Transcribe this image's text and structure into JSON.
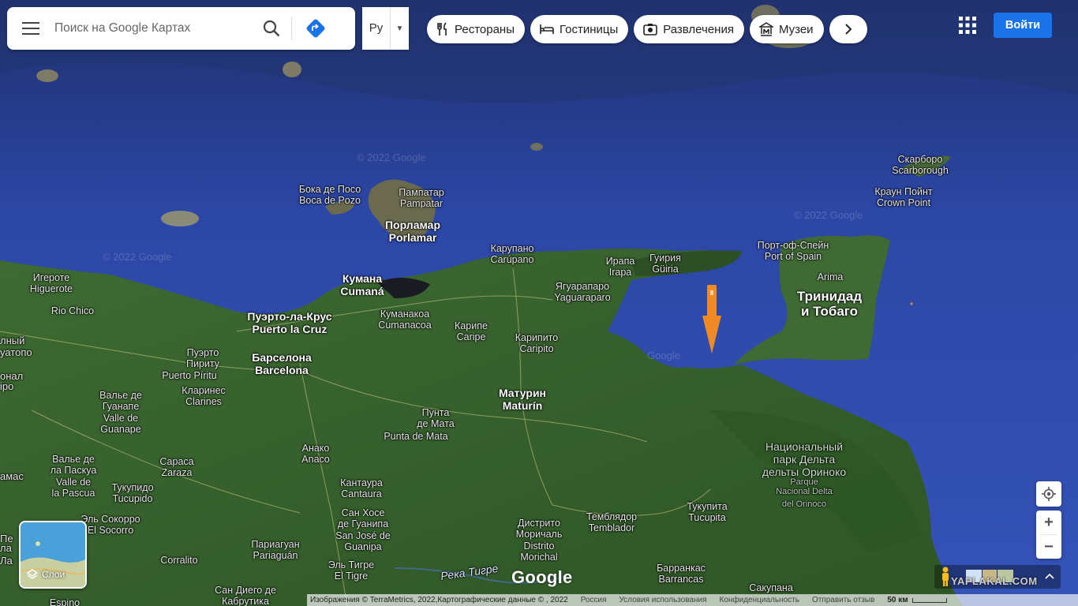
{
  "search": {
    "placeholder": "Поиск на Google Картах"
  },
  "language": {
    "code": "Ру"
  },
  "chips": [
    {
      "label": "Рестораны",
      "icon": "fork-knife-icon"
    },
    {
      "label": "Гостиницы",
      "icon": "bed-icon"
    },
    {
      "label": "Развлечения",
      "icon": "camera-icon"
    },
    {
      "label": "Музеи",
      "icon": "museum-icon"
    }
  ],
  "signin": {
    "label": "Войти"
  },
  "layers": {
    "label": "Слои"
  },
  "zoom": {
    "in": "+",
    "out": "−"
  },
  "google_logo": "Google",
  "yaplakal": "YAPLAKAL.COM",
  "attribution": {
    "credit": "Изображения © TerraMetrics, 2022,Картографические данные © , 2022",
    "country": "Россия",
    "terms": "Условия использования",
    "privacy": "Конфиденциальность",
    "feedback": "Отправить отзыв",
    "scale": "50 км"
  },
  "watermarks": [
    "© 2022 Google",
    "© 2022 Google",
    "© 2022 Google",
    "Google"
  ],
  "places": [
    {
      "l1": "Бока де Посо",
      "l2": "Boca de Pozo",
      "cls": "lbl-small"
    },
    {
      "l1": "Пампатар",
      "l2": "Pampatar",
      "cls": "lbl-small"
    },
    {
      "l1": "Порламар",
      "l2": "Porlamar",
      "cls": "lbl-mid"
    },
    {
      "l1": "Карупано",
      "l2": "Carúpano",
      "cls": "lbl-small"
    },
    {
      "l1": "Ирапа",
      "l2": "Irapa",
      "cls": "lbl-small"
    },
    {
      "l1": "Гуирия",
      "l2": "Güiria",
      "cls": "lbl-small"
    },
    {
      "l1": "Ягуарапаро",
      "l2": "Yaguaraparo",
      "cls": "lbl-small"
    },
    {
      "l1": "Кумана",
      "l2": "Cumaná",
      "cls": "lbl-mid"
    },
    {
      "l1": "Игероте",
      "l2": "Higuerote",
      "cls": "lbl-small"
    },
    {
      "l1": "Rio Chico",
      "l2": "",
      "cls": "lbl-small"
    },
    {
      "l1": "Пуэрто-ла-Крус",
      "l2": "Puerto la Cruz",
      "cls": "lbl-mid"
    },
    {
      "l1": "Куманакоа",
      "l2": "Cumanacoa",
      "cls": "lbl-small"
    },
    {
      "l1": "Карипе",
      "l2": "Caripe",
      "cls": "lbl-small"
    },
    {
      "l1": "Карипито",
      "l2": "Caripito",
      "cls": "lbl-small"
    },
    {
      "l1": "Пуэрто",
      "l2": "Пириту",
      "cls": "lbl-small"
    },
    {
      "l1": "Puerto Píritu",
      "l2": "",
      "cls": "lbl-small"
    },
    {
      "l1": "Барселона",
      "l2": "Barcelona",
      "cls": "lbl-mid"
    },
    {
      "l1": "Кларинес",
      "l2": "Clarines",
      "cls": "lbl-small"
    },
    {
      "l1": "Матурин",
      "l2": "Maturín",
      "cls": "lbl-mid"
    },
    {
      "l1": "Пунта",
      "l2": "де Мата",
      "cls": "lbl-small"
    },
    {
      "l1": "Punta de Mata",
      "l2": "",
      "cls": "lbl-small"
    },
    {
      "l1": "Валье де",
      "l2": "Гуанапе",
      "cls": "lbl-small"
    },
    {
      "l1": "Valle de",
      "l2": "Guanape",
      "cls": "lbl-small"
    },
    {
      "l1": "Анако",
      "l2": "Anaco",
      "cls": "lbl-small"
    },
    {
      "l1": "Валье де",
      "l2": "ла Паскуа",
      "cls": "lbl-small"
    },
    {
      "l1": "Valle de",
      "l2": "la Pascua",
      "cls": "lbl-small"
    },
    {
      "l1": "Сараса",
      "l2": "Zaraza",
      "cls": "lbl-small"
    },
    {
      "l1": "Тукупидо",
      "l2": "Tucupido",
      "cls": "lbl-small"
    },
    {
      "l1": "Кантаура",
      "l2": "Cantaura",
      "cls": "lbl-small"
    },
    {
      "l1": "Сан Хосе",
      "l2": "де Гуанипа",
      "cls": "lbl-small"
    },
    {
      "l1": "San José de",
      "l2": "Guanipa",
      "cls": "lbl-small"
    },
    {
      "l1": "Эль Сокорро",
      "l2": "El Socorro",
      "cls": "lbl-small"
    },
    {
      "l1": "Corralito",
      "l2": "",
      "cls": "lbl-small"
    },
    {
      "l1": "Париагуан",
      "l2": "Pariaguán",
      "cls": "lbl-small"
    },
    {
      "l1": "Эль Тигре",
      "l2": "El Tigre",
      "cls": "lbl-small"
    },
    {
      "l1": "Сан Диего де",
      "l2": "Кабрутика",
      "cls": "lbl-small"
    },
    {
      "l1": "Espino",
      "l2": "",
      "cls": "lbl-small"
    },
    {
      "l1": "Дистрито",
      "l2": "Моричаль",
      "cls": "lbl-small"
    },
    {
      "l1": "Distrito",
      "l2": "Morichal",
      "cls": "lbl-small"
    },
    {
      "l1": "Темблядор",
      "l2": "Temblador",
      "cls": "lbl-small"
    },
    {
      "l1": "Тукупита",
      "l2": "Tucupita",
      "cls": "lbl-small"
    },
    {
      "l1": "Барранкас",
      "l2": "Barrancas",
      "cls": "lbl-small"
    },
    {
      "l1": "Сакупана",
      "l2": "",
      "cls": "lbl-small"
    },
    {
      "l1": "Порт-оф-Спейн",
      "l2": "Port of Spain",
      "cls": "lbl-small"
    },
    {
      "l1": "Arima",
      "l2": "",
      "cls": "lbl-small"
    },
    {
      "l1": "Тринидад",
      "l2": "и Тобаго",
      "cls": "lbl-big"
    },
    {
      "l1": "Скарборо",
      "l2": "Scarborough",
      "cls": "lbl-small"
    },
    {
      "l1": "Краун Пойнт",
      "l2": "Crown Point",
      "cls": "lbl-small"
    },
    {
      "l1": "Национальный",
      "l2": "парк Дельта",
      "cls": "lbl-park"
    },
    {
      "l1": "дельты Ориноко",
      "l2": "",
      "cls": "lbl-park"
    },
    {
      "l1": "Parque",
      "l2": "Nacional Delta",
      "cls": "lbl-park-sub"
    },
    {
      "l1": "del Orinoco",
      "l2": "",
      "cls": "lbl-park-sub"
    },
    {
      "l1": "Река Тигре",
      "l2": "",
      "cls": "lbl-river"
    }
  ],
  "edge_labels": [
    "лный",
    "уатопо",
    "онал",
    "ipo",
    "амас",
    "Пе",
    "ла",
    "Ла"
  ]
}
